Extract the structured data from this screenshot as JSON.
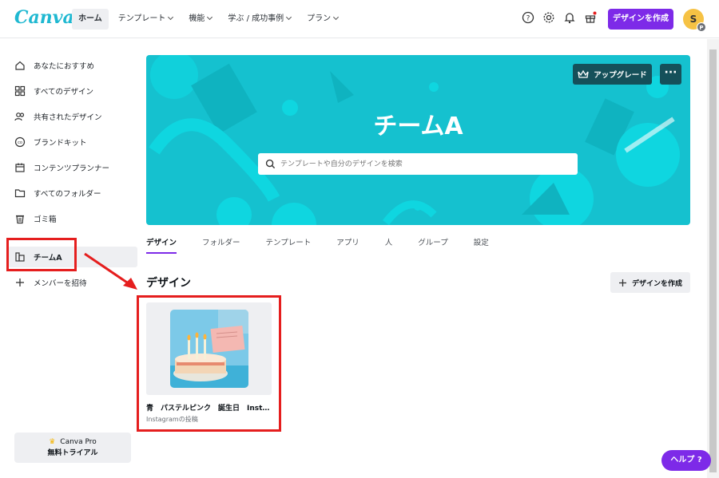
{
  "app": {
    "logo": "Canva"
  },
  "nav": {
    "items": [
      {
        "label": "ホーム",
        "active": true,
        "chevron": false
      },
      {
        "label": "テンプレート",
        "chevron": true
      },
      {
        "label": "機能",
        "chevron": true
      },
      {
        "label": "学ぶ / 成功事例",
        "chevron": true
      },
      {
        "label": "プラン",
        "chevron": true
      }
    ],
    "icons": [
      "help-icon",
      "settings-icon",
      "bell-icon",
      "gift-icon"
    ],
    "create_label": "デザインを作成",
    "avatar_initial": "S",
    "avatar_badge": "P"
  },
  "sidebar": {
    "items": [
      {
        "label": "あなたにおすすめ",
        "icon": "home-icon"
      },
      {
        "label": "すべてのデザイン",
        "icon": "grid-icon"
      },
      {
        "label": "共有されたデザイン",
        "icon": "people-icon"
      },
      {
        "label": "ブランドキット",
        "icon": "brand-icon"
      },
      {
        "label": "コンテンツプランナー",
        "icon": "calendar-icon"
      },
      {
        "label": "すべてのフォルダー",
        "icon": "folder-icon"
      },
      {
        "label": "ゴミ箱",
        "icon": "trash-icon"
      }
    ],
    "team_label": "チームA",
    "invite_label": "メンバーを招待",
    "trial_line1": "Canva Pro",
    "trial_line2": "無料トライアル"
  },
  "banner": {
    "title": "チームA",
    "search_placeholder": "テンプレートや自分のデザインを検索",
    "upgrade_label": "アップグレード",
    "more_label": "···",
    "color": "#15c1cf"
  },
  "tabs": [
    "デザイン",
    "フォルダー",
    "テンプレート",
    "アプリ",
    "人",
    "グループ",
    "設定"
  ],
  "designs": {
    "section_title": "デザイン",
    "create_label": "デザインを作成",
    "cards": [
      {
        "title": "青　パステルピンク　誕生日　Instagram",
        "subtitle": "Instagramの投稿"
      }
    ]
  },
  "help_label": "ヘルプ ?",
  "colors": {
    "accent": "#7d2ae8",
    "annotation": "#e51e1e",
    "banner": "#15c1cf"
  }
}
